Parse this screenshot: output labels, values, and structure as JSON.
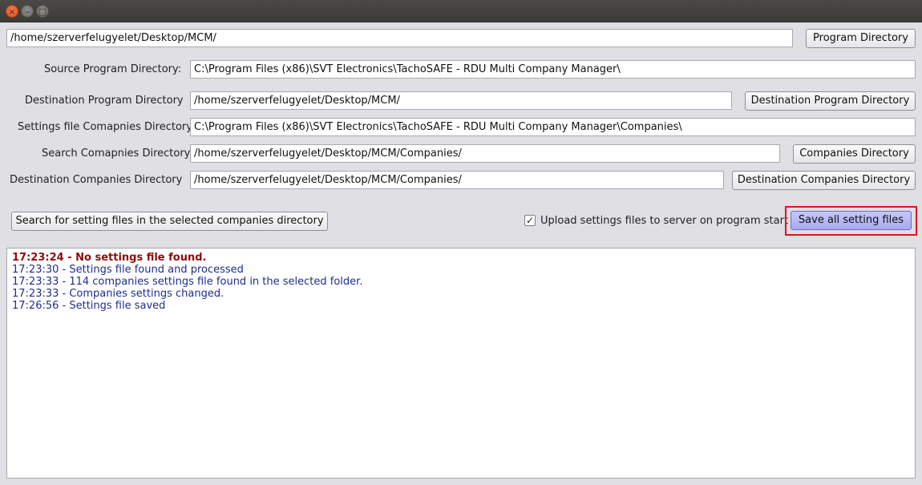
{
  "window": {
    "controls": {
      "close_glyph": "×",
      "minimize_glyph": "–",
      "maximize_glyph": "□"
    }
  },
  "program_dir": {
    "value": "/home/szerverfelugyelet/Desktop/MCM/",
    "button": "Program Directory"
  },
  "source_program_dir": {
    "label": "Source Program Directory:",
    "value": "C:\\Program Files (x86)\\SVT Electronics\\TachoSAFE - RDU Multi Company Manager\\"
  },
  "destination_program_dir": {
    "label": "Destination Program Directory",
    "value": "/home/szerverfelugyelet/Desktop/MCM/",
    "button": "Destination Program Directory"
  },
  "settings_companies_dir": {
    "label": "Settings file Comapnies Directory",
    "value": "C:\\Program Files (x86)\\SVT Electronics\\TachoSAFE - RDU Multi Company Manager\\Companies\\"
  },
  "search_companies_dir": {
    "label": "Search Comapnies Directory",
    "value": "/home/szerverfelugyelet/Desktop/MCM/Companies/",
    "button": "Companies Directory"
  },
  "destination_companies_dir": {
    "label": "Destination Companies Directory",
    "value": "/home/szerverfelugyelet/Desktop/MCM/Companies/",
    "button": "Destination Companies Directory"
  },
  "actions": {
    "search_button": "Search for setting files in the selected companies directory",
    "upload_checkbox_label": "Upload settings files to server on program start",
    "upload_checked": true,
    "checkmark_glyph": "✓",
    "save_button": "Save all setting files"
  },
  "log": [
    {
      "text": "17:23:24 - No settings file found.",
      "type": "error"
    },
    {
      "text": "17:23:30 - Settings file found and processed",
      "type": "info"
    },
    {
      "text": "17:23:33 - 114 companies settings file found in the selected folder.",
      "type": "info"
    },
    {
      "text": "17:23:33 - Companies settings changed.",
      "type": "info"
    },
    {
      "text": "17:26:56 - Settings file saved",
      "type": "info"
    }
  ],
  "colors": {
    "log_info": "#1e2d8c",
    "log_error": "#8b0d0d",
    "highlight": "#e3141c"
  }
}
